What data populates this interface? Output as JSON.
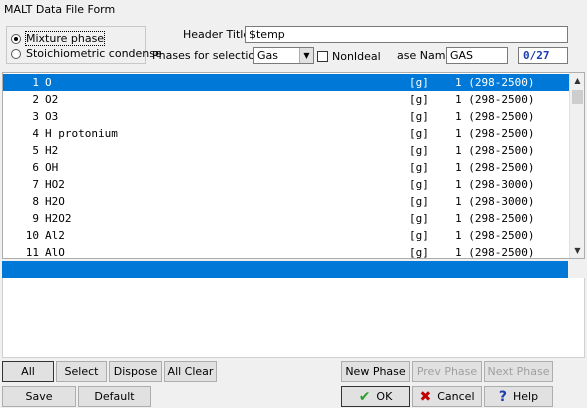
{
  "window": {
    "title": "MALT Data File Form"
  },
  "phase_group": {
    "options": [
      {
        "label": "Mixture phase",
        "checked": true
      },
      {
        "label": "Stoichiometric condense",
        "checked": false
      }
    ]
  },
  "header": {
    "header_title_label": "Header Title",
    "header_title_value": "$temp",
    "phases_label": "Phases for selection",
    "phases_value": "Gas",
    "nonideal_label": "NonIdeal",
    "phase_name_label": "ase Name",
    "phase_name_value": "GAS",
    "count": "0/27"
  },
  "species_list": {
    "rows": [
      {
        "num": "1",
        "name": "O",
        "state": "[g]",
        "range": "1 (298-2500)",
        "selected": true
      },
      {
        "num": "2",
        "name": "O2",
        "state": "[g]",
        "range": "1 (298-2500)"
      },
      {
        "num": "3",
        "name": "O3",
        "state": "[g]",
        "range": "1 (298-2500)"
      },
      {
        "num": "4",
        "name": "H protonium",
        "state": "[g]",
        "range": "1 (298-2500)"
      },
      {
        "num": "5",
        "name": "H2",
        "state": "[g]",
        "range": "1 (298-2500)"
      },
      {
        "num": "6",
        "name": "OH",
        "state": "[g]",
        "range": "1 (298-2500)"
      },
      {
        "num": "7",
        "name": "HO2",
        "state": "[g]",
        "range": "1 (298-3000)"
      },
      {
        "num": "8",
        "name": "H2O",
        "state": "[g]",
        "range": "1 (298-3000)"
      },
      {
        "num": "9",
        "name": "H2O2",
        "state": "[g]",
        "range": "1 (298-2500)"
      },
      {
        "num": "10",
        "name": "Al2",
        "state": "[g]",
        "range": "1 (298-2500)"
      },
      {
        "num": "11",
        "name": "AlO",
        "state": "[g]",
        "range": "1 (298-2500)"
      }
    ]
  },
  "buttons": {
    "all": "All",
    "select": "Select",
    "dispose": "Dispose",
    "all_clear": "All Clear",
    "new_phase": "New Phase",
    "prev_phase": "Prev Phase",
    "next_phase": "Next Phase",
    "save": "Save",
    "default": "Default",
    "ok": "OK",
    "cancel": "Cancel",
    "help": "Help"
  },
  "colors": {
    "selection": "#0078d7",
    "count_text": "#1a3cb0",
    "ok_icon": "#2e9b2e",
    "cancel_icon": "#c00000",
    "help_icon": "#1a3cb0"
  }
}
